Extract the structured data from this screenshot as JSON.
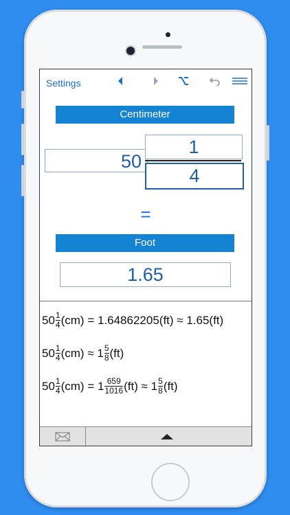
{
  "toolbar": {
    "settings_label": "Settings",
    "icons": [
      "arrow-left-icon",
      "arrow-right-icon",
      "option-key-icon",
      "undo-icon",
      "menu-icon"
    ]
  },
  "converter": {
    "from_unit": "Centimeter",
    "whole": "50",
    "numerator": "1",
    "denominator": "4",
    "equals": "=",
    "to_unit": "Foot",
    "result": "1.65"
  },
  "results": {
    "line1": {
      "whole": "50",
      "num": "1",
      "den": "4",
      "from": "(cm) = 1.64862205(ft) ≈ 1.65(ft)"
    },
    "line2": {
      "whole": "50",
      "num": "1",
      "den": "4",
      "mid": "(cm) ≈ 1",
      "num2": "5",
      "den2": "8",
      "end": "(ft)"
    },
    "line3": {
      "whole": "50",
      "num": "1",
      "den": "4",
      "mid": "(cm) = 1",
      "num2": "659",
      "den2": "1016",
      "mid2": "(ft) ≈ 1",
      "num3": "5",
      "den3": "8",
      "end": "(ft)"
    }
  },
  "colors": {
    "accent": "#1583d3",
    "background": "#2f8df0",
    "text_blue": "#1e5ea6"
  }
}
